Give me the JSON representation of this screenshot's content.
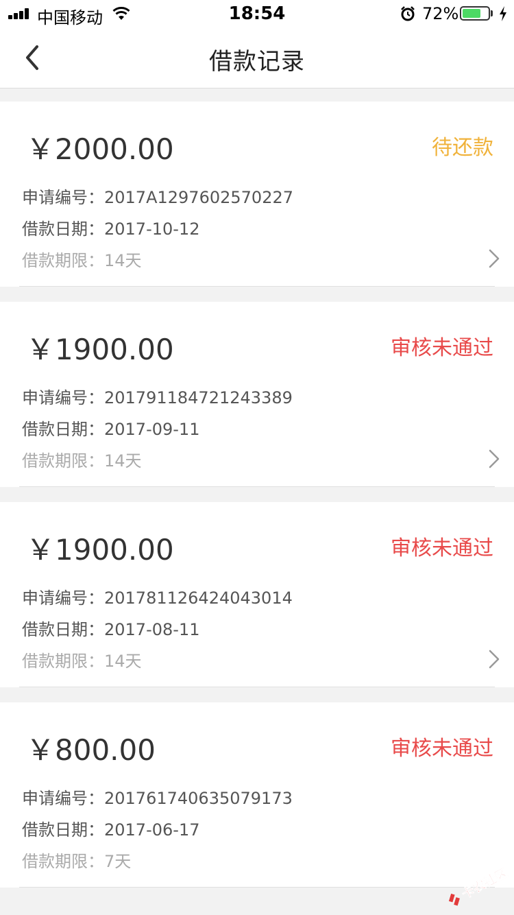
{
  "status_bar": {
    "carrier": "中国移动",
    "time": "18:54",
    "battery_percent": "72%",
    "battery_level": 0.72,
    "battery_color": "#4cd964"
  },
  "nav": {
    "title": "借款记录",
    "back_icon": "chevron-left-icon"
  },
  "colors": {
    "pending": "#f0b23a",
    "rejected": "#e84a4a"
  },
  "records": [
    {
      "amount": "￥2000.00",
      "status": "待还款",
      "status_type": "pending",
      "app_no_label": "申请编号：",
      "app_no": "2017A1297602570227",
      "date_label": "借款日期：",
      "date": "2017-10-12",
      "term_label": "借款期限：",
      "term": "14天"
    },
    {
      "amount": "￥1900.00",
      "status": "审核未通过",
      "status_type": "rejected",
      "app_no_label": "申请编号：",
      "app_no": "201791184721243389",
      "date_label": "借款日期：",
      "date": "2017-09-11",
      "term_label": "借款期限：",
      "term": "14天"
    },
    {
      "amount": "￥1900.00",
      "status": "审核未通过",
      "status_type": "rejected",
      "app_no_label": "申请编号：",
      "app_no": "201781126424043014",
      "date_label": "借款日期：",
      "date": "2017-08-11",
      "term_label": "借款期限：",
      "term": "14天"
    },
    {
      "amount": "￥800.00",
      "status": "审核未通过",
      "status_type": "rejected",
      "app_no_label": "申请编号：",
      "app_no": "201761740635079173",
      "date_label": "借款日期：",
      "date": "2017-06-17",
      "term_label": "借款期限：",
      "term": "7天"
    }
  ],
  "watermark": {
    "text": "卡农社区"
  }
}
